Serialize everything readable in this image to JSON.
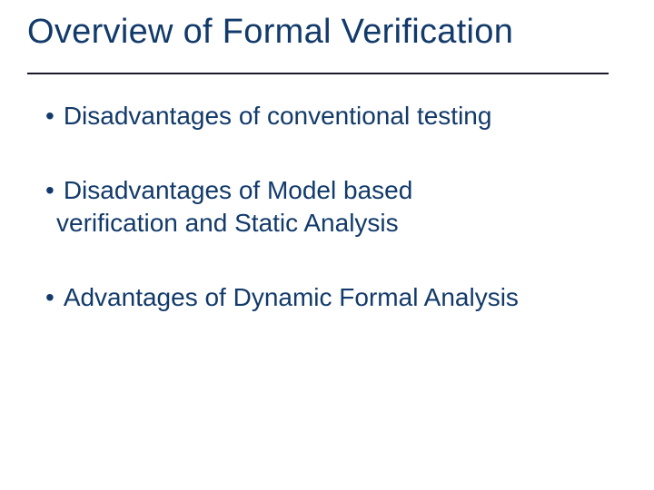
{
  "title": "Overview of Formal Verification",
  "bullets": [
    {
      "first": "Disadvantages of conventional testing",
      "cont": null
    },
    {
      "first": "Disadvantages of Model based",
      "cont": "verification and Static Analysis"
    },
    {
      "first": "Advantages of Dynamic Formal Analysis",
      "cont": null
    }
  ]
}
